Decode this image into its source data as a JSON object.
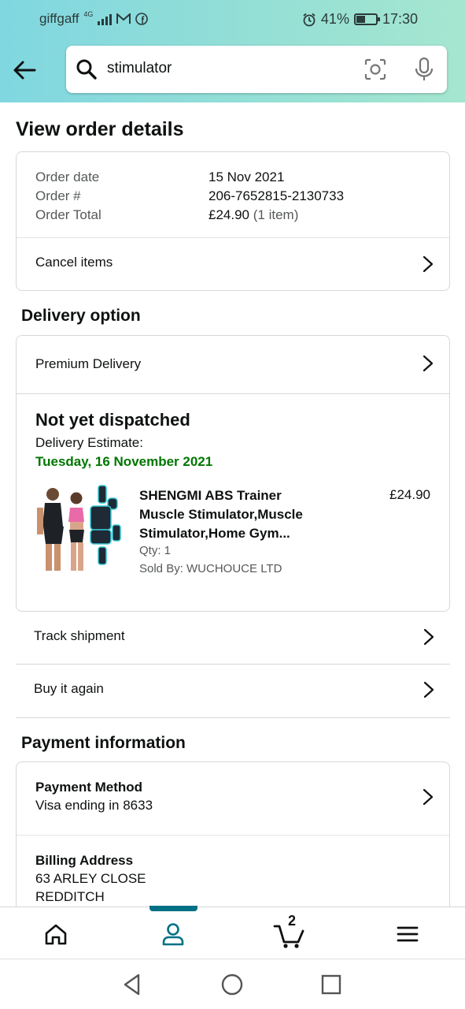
{
  "status_bar": {
    "carrier": "giffgaff",
    "network": "4G",
    "battery": "41%",
    "time": "17:30"
  },
  "search": {
    "query": "stimulator"
  },
  "page_title": "View order details",
  "order_summary": {
    "labels": [
      "Order date",
      "Order #",
      "Order Total"
    ],
    "date": "15 Nov 2021",
    "number": "206-7652815-2130733",
    "total": "£24.90",
    "items": "(1 item)",
    "cancel_label": "Cancel items"
  },
  "delivery": {
    "heading": "Delivery option",
    "option": "Premium Delivery",
    "status": "Not yet dispatched",
    "estimate_label": "Delivery Estimate:",
    "estimate_date": "Tuesday, 16 November 2021"
  },
  "product": {
    "title_line1": "SHENGMI ABS Trainer",
    "title_line2": "Muscle Stimulator,Muscle",
    "title_line3": "Stimulator,Home Gym...",
    "price": "£24.90",
    "qty": "Qty: 1",
    "seller": "Sold By: WUCHOUCE LTD"
  },
  "actions": {
    "track": "Track shipment",
    "buy_again": "Buy it again"
  },
  "payment": {
    "heading": "Payment information",
    "method_label": "Payment Method",
    "method_value": "Visa ending in 8633",
    "billing_label": "Billing Address",
    "billing_line1": "63 ARLEY CLOSE",
    "billing_line2": "REDDITCH"
  },
  "bottom_nav": {
    "cart_count": "2"
  },
  "colors": {
    "header_start": "#80d7e0",
    "header_end": "#a5e6cf",
    "accent": "#007185",
    "green": "#007600"
  }
}
